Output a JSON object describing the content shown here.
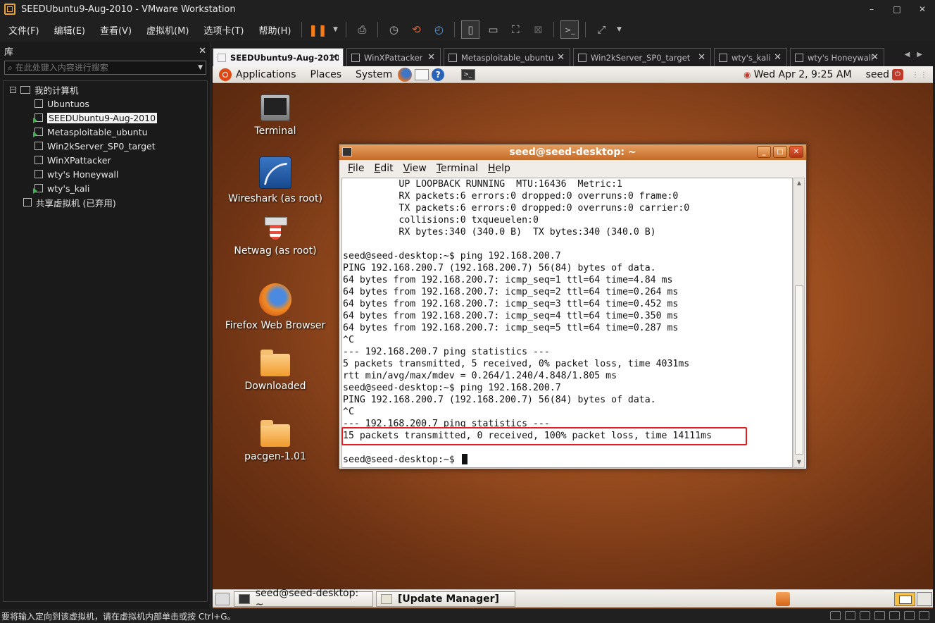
{
  "window": {
    "title": "SEEDUbuntu9-Aug-2010 - VMware Workstation",
    "controls": [
      "–",
      "□",
      "✕"
    ]
  },
  "menu": [
    "文件(F)",
    "编辑(E)",
    "查看(V)",
    "虚拟机(M)",
    "选项卡(T)",
    "帮助(H)"
  ],
  "toolbar": {
    "pause_icon": "pause-icon",
    "icons": [
      "print-icon",
      "snapshot-icon",
      "revert-icon",
      "snapshot-manager-icon",
      "console-view-icon",
      "full-screen-icon",
      "unity-icon"
    ],
    "accent_color": "#f27b1a"
  },
  "library": {
    "title": "库",
    "close": "✕",
    "search_placeholder": "在此处键入内容进行搜索",
    "root": "我的计算机",
    "items": [
      {
        "label": "Ubuntuos",
        "running": false,
        "selected": false
      },
      {
        "label": "SEEDUbuntu9-Aug-2010",
        "running": true,
        "selected": true
      },
      {
        "label": "Metasploitable_ubuntu",
        "running": true,
        "selected": false
      },
      {
        "label": "Win2kServer_SP0_target",
        "running": false,
        "selected": false
      },
      {
        "label": "WinXPattacker",
        "running": false,
        "selected": false
      },
      {
        "label": "wty's Honeywall",
        "running": false,
        "selected": false
      },
      {
        "label": "wty's_kali",
        "running": true,
        "selected": false
      }
    ],
    "shared": "共享虚拟机 (已弃用)"
  },
  "tabs": [
    {
      "label": "SEEDUbuntu9-Aug-2010",
      "active": true
    },
    {
      "label": "WinXPattacker",
      "active": false
    },
    {
      "label": "Metasploitable_ubuntu",
      "active": false
    },
    {
      "label": "Win2kServer_SP0_target",
      "active": false
    },
    {
      "label": "wty's_kali",
      "active": false
    },
    {
      "label": "wty's Honeywall",
      "active": false
    }
  ],
  "tab_close": "✕",
  "tab_arrows": "◀▶",
  "gnome": {
    "menus": [
      "Applications",
      "Places",
      "System"
    ],
    "clock": "Wed Apr  2,  9:25 AM",
    "user": "seed",
    "help_glyph": "?"
  },
  "desktop": {
    "icons": [
      {
        "label": "Terminal",
        "kind": "terminal-icon"
      },
      {
        "label": "Wireshark (as root)",
        "kind": "wireshark-icon"
      },
      {
        "label": "Netwag (as root)",
        "kind": "netwag-icon"
      },
      {
        "label": "Firefox Web Browser",
        "kind": "firefox-icon"
      },
      {
        "label": "Downloaded",
        "kind": "folder-icon"
      },
      {
        "label": "pacgen-1.01",
        "kind": "folder-icon"
      }
    ]
  },
  "terminal": {
    "title": "seed@seed-desktop: ~",
    "menu": [
      "File",
      "Edit",
      "View",
      "Terminal",
      "Help"
    ],
    "titlebar_color": "#c66a28",
    "lines": [
      "          UP LOOPBACK RUNNING  MTU:16436  Metric:1",
      "          RX packets:6 errors:0 dropped:0 overruns:0 frame:0",
      "          TX packets:6 errors:0 dropped:0 overruns:0 carrier:0",
      "          collisions:0 txqueuelen:0",
      "          RX bytes:340 (340.0 B)  TX bytes:340 (340.0 B)",
      "",
      "seed@seed-desktop:~$ ping 192.168.200.7",
      "PING 192.168.200.7 (192.168.200.7) 56(84) bytes of data.",
      "64 bytes from 192.168.200.7: icmp_seq=1 ttl=64 time=4.84 ms",
      "64 bytes from 192.168.200.7: icmp_seq=2 ttl=64 time=0.264 ms",
      "64 bytes from 192.168.200.7: icmp_seq=3 ttl=64 time=0.452 ms",
      "64 bytes from 192.168.200.7: icmp_seq=4 ttl=64 time=0.350 ms",
      "64 bytes from 192.168.200.7: icmp_seq=5 ttl=64 time=0.287 ms",
      "^C",
      "--- 192.168.200.7 ping statistics ---",
      "5 packets transmitted, 5 received, 0% packet loss, time 4031ms",
      "rtt min/avg/max/mdev = 0.264/1.240/4.848/1.805 ms",
      "seed@seed-desktop:~$ ping 192.168.200.7",
      "PING 192.168.200.7 (192.168.200.7) 56(84) bytes of data.",
      "^C",
      "--- 192.168.200.7 ping statistics ---",
      "15 packets transmitted, 0 received, 100% packet loss, time 14111ms",
      "",
      "seed@seed-desktop:~$ "
    ],
    "highlight_color": "#e02020"
  },
  "taskbar": {
    "buttons": [
      "seed@seed-desktop: ~",
      "[Update Manager]"
    ]
  },
  "status": {
    "text": "要将输入定向到该虚拟机，请在虚拟机内部单击或按 Ctrl+G。"
  }
}
